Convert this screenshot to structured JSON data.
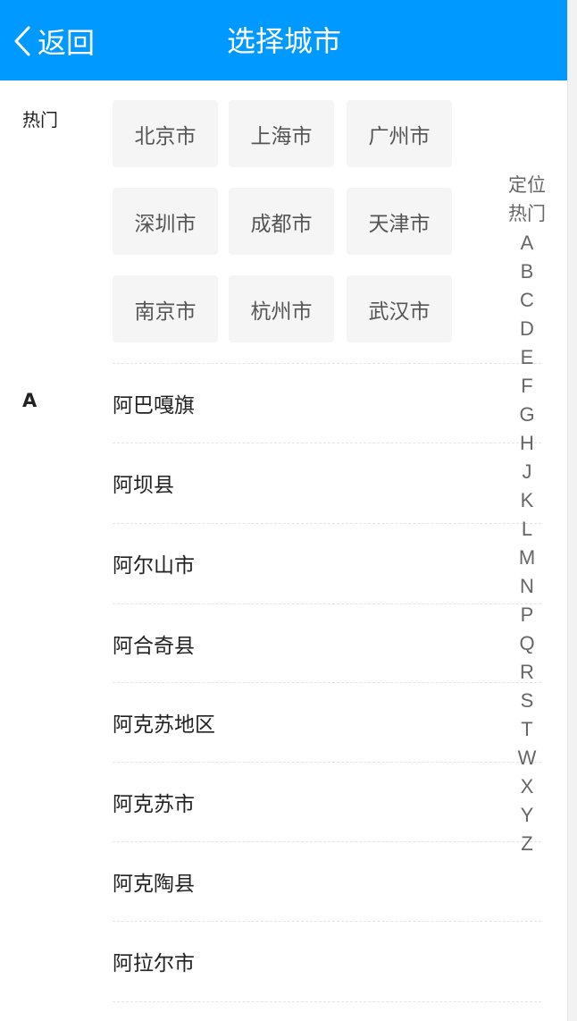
{
  "header": {
    "back_label": "返回",
    "title": "选择城市",
    "background": "#0099ff"
  },
  "hot": {
    "label": "热门",
    "cities": [
      "北京市",
      "上海市",
      "广州市",
      "深圳市",
      "成都市",
      "天津市",
      "南京市",
      "杭州市",
      "武汉市"
    ]
  },
  "sections": [
    {
      "letter": "A",
      "cities": [
        "阿巴嘎旗",
        "阿坝县",
        "阿尔山市",
        "阿合奇县",
        "阿克苏地区",
        "阿克苏市",
        "阿克陶县",
        "阿拉尔市"
      ]
    }
  ],
  "index": [
    "定位",
    "热门",
    "A",
    "B",
    "C",
    "D",
    "E",
    "F",
    "G",
    "H",
    "J",
    "K",
    "L",
    "M",
    "N",
    "P",
    "Q",
    "R",
    "S",
    "T",
    "W",
    "X",
    "Y",
    "Z"
  ],
  "icons": {
    "back": "chevron-left-icon"
  }
}
